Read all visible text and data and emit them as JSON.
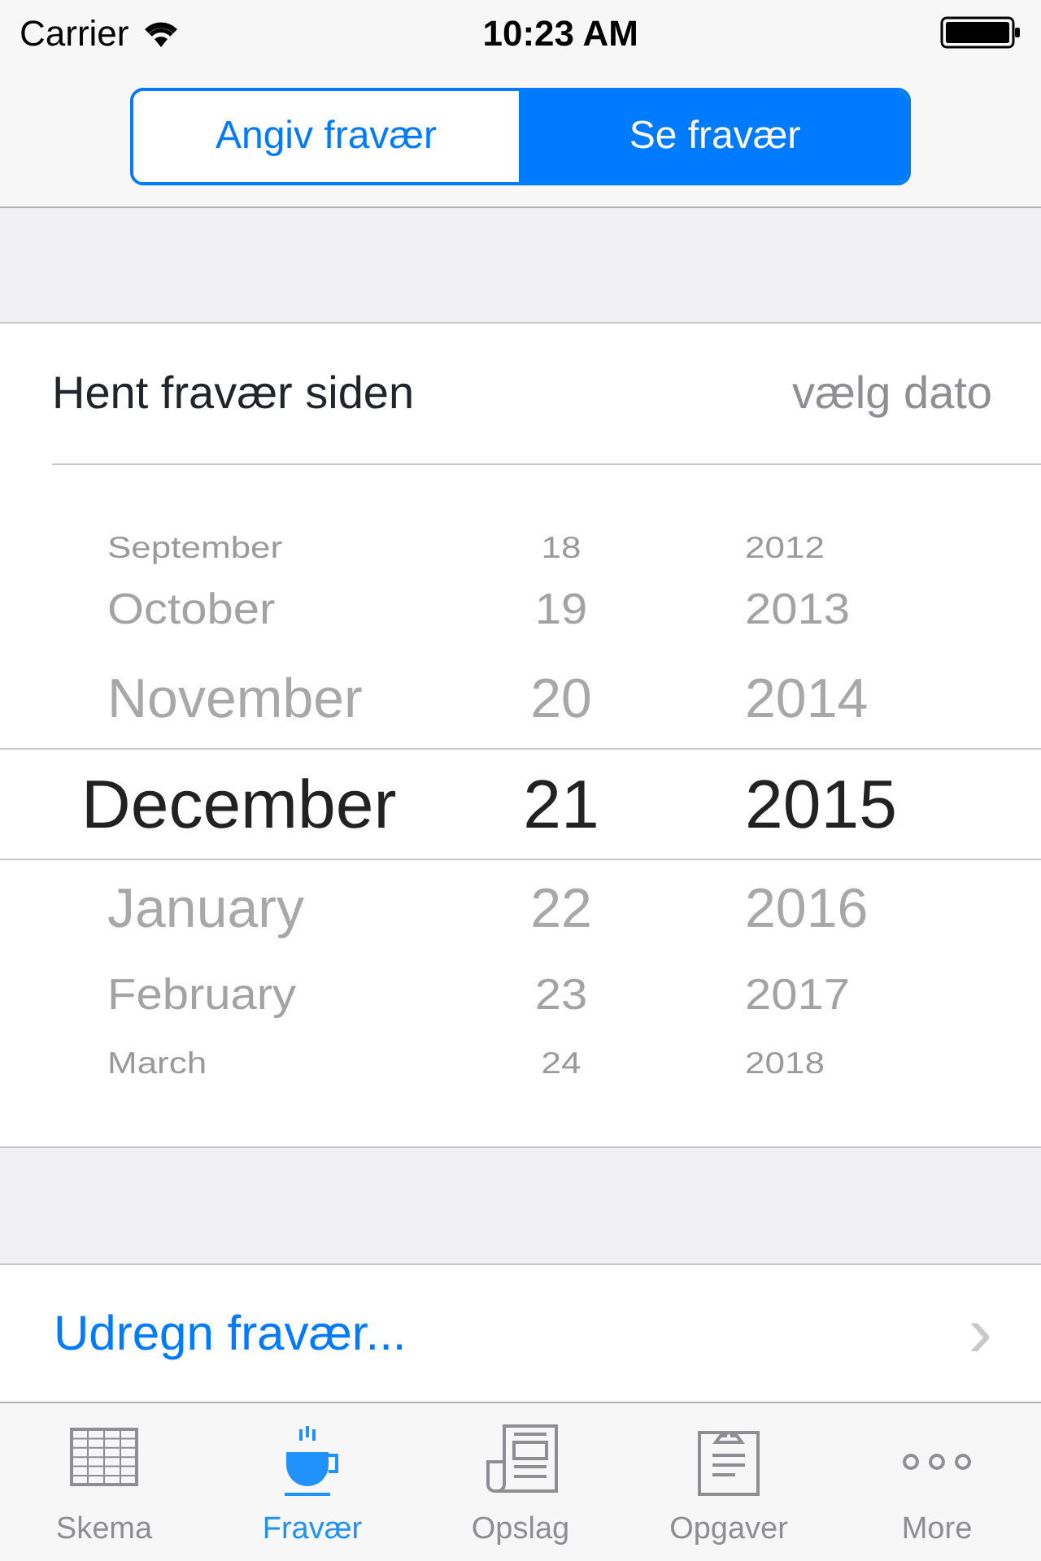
{
  "status_bar": {
    "carrier": "Carrier",
    "time": "10:23 AM"
  },
  "segments": [
    {
      "label": "Angiv fravær",
      "selected": false
    },
    {
      "label": "Se fravær",
      "selected": true
    }
  ],
  "date_row": {
    "label": "Hent fravær siden",
    "value": "vælg dato"
  },
  "picker": {
    "rows": [
      {
        "month": "September",
        "day": "18",
        "year": "2012",
        "selected": false
      },
      {
        "month": "October",
        "day": "19",
        "year": "2013",
        "selected": false
      },
      {
        "month": "November",
        "day": "20",
        "year": "2014",
        "selected": false
      },
      {
        "month": "December",
        "day": "21",
        "year": "2015",
        "selected": true
      },
      {
        "month": "January",
        "day": "22",
        "year": "2016",
        "selected": false
      },
      {
        "month": "February",
        "day": "23",
        "year": "2017",
        "selected": false
      },
      {
        "month": "March",
        "day": "24",
        "year": "2018",
        "selected": false
      }
    ]
  },
  "action": {
    "label": "Udregn fravær...",
    "chevron": "›"
  },
  "tab_bar": [
    {
      "label": "Skema",
      "selected": false
    },
    {
      "label": "Fravær",
      "selected": true
    },
    {
      "label": "Opslag",
      "selected": false
    },
    {
      "label": "Opgaver",
      "selected": false
    },
    {
      "label": "More",
      "selected": false
    }
  ]
}
